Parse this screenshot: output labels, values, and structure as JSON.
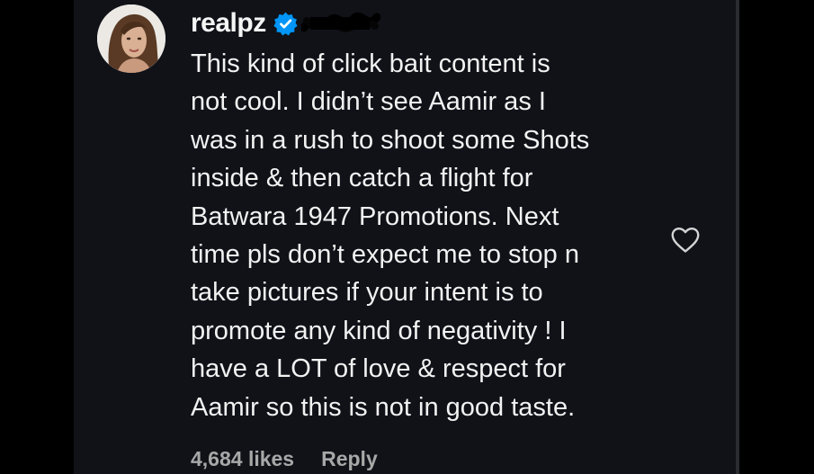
{
  "comment": {
    "username": "realpz",
    "verified_icon": "verified-badge-icon",
    "lines": [
      "This kind of click bait content is",
      "not cool. I didn’t see Aamir as I",
      "was in a rush to shoot some Shots",
      "inside & then catch a flight for",
      "Batwara 1947 Promotions. Next",
      "time pls don’t expect me to stop n",
      "take pictures if your intent is to",
      "promote any kind of negativity ! I",
      "have a LOT of love & respect for",
      "Aamir so this is not in good taste."
    ],
    "likes": "4,684 likes",
    "reply_label": "Reply",
    "like_icon": "heart-outline-icon"
  },
  "colors": {
    "background": "#101218",
    "text": "#f2f2f2",
    "muted": "#a8a8a8",
    "verified": "#0095f6"
  }
}
